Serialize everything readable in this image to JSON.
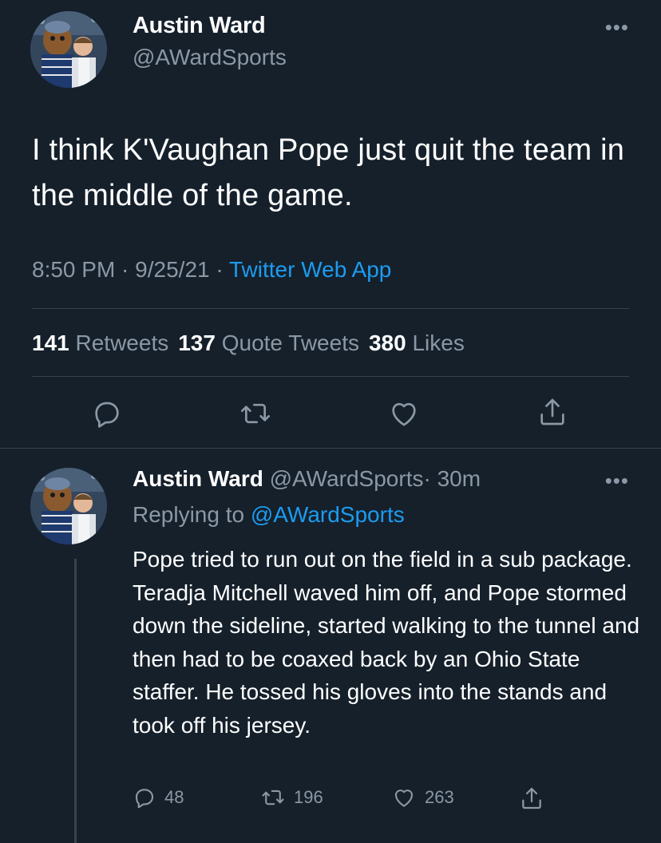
{
  "main_tweet": {
    "author_name": "Austin Ward",
    "author_handle": "@AWardSports",
    "more_label": "•••",
    "text": "I think K'Vaughan Pope just quit the team in the middle of the game.",
    "time": "8:50 PM",
    "date": "9/25/21",
    "separator": " · ",
    "source": "Twitter Web App",
    "retweets_count": "141",
    "retweets_label": "Retweets",
    "quotes_count": "137",
    "quotes_label": "Quote Tweets",
    "likes_count": "380",
    "likes_label": "Likes",
    "icons": [
      "reply-icon",
      "retweet-icon",
      "like-icon",
      "share-icon"
    ]
  },
  "reply_tweet": {
    "author_name": "Austin Ward",
    "author_handle": "@AWardSports",
    "time_ago": "· 30m",
    "more_label": "•••",
    "replying_prefix": "Replying to",
    "replying_handle": "@AWardSports",
    "text": "Pope tried to run out on the field in a sub package. Teradja Mitchell waved him off, and Pope stormed down the sideline, started walking to the tunnel and then had to be coaxed back by an Ohio State staffer. He tossed his gloves into the stands and took off his jersey.",
    "reply_count": "48",
    "retweet_count": "196",
    "like_count": "263"
  },
  "colors": {
    "background": "#15202b",
    "text_primary": "#ffffff",
    "text_secondary": "#8b98a5",
    "accent": "#1d9bf0",
    "divider": "#38444d"
  }
}
